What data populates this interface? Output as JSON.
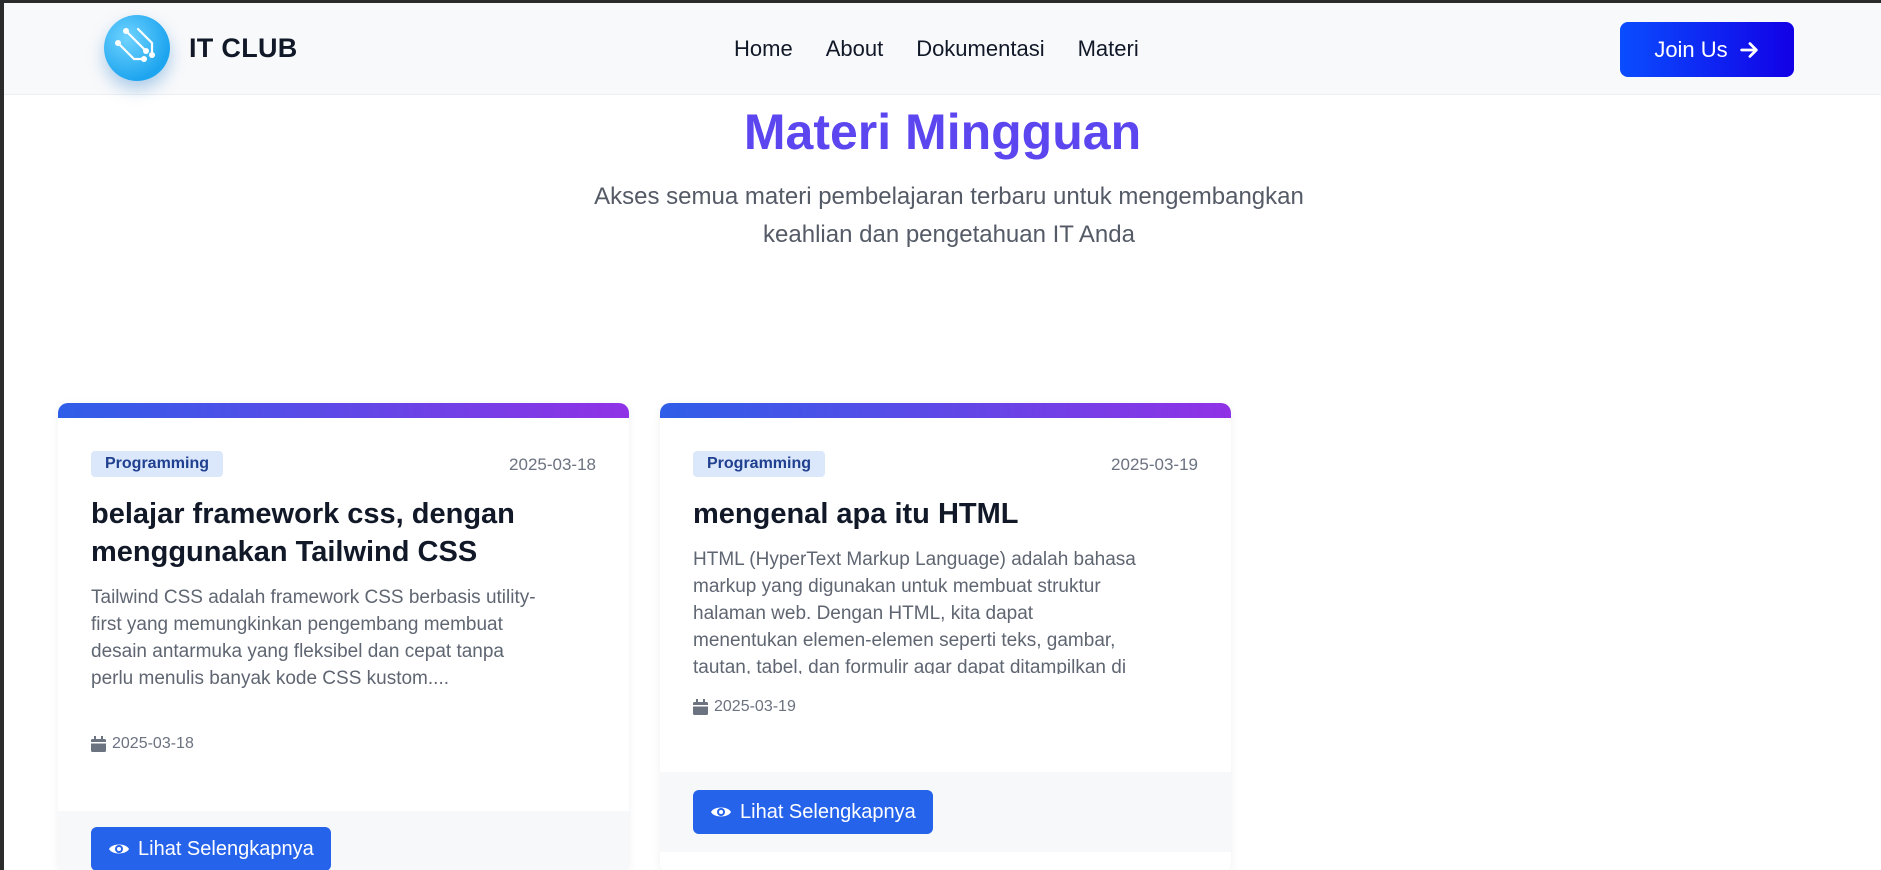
{
  "brand": {
    "name": "IT CLUB"
  },
  "nav": {
    "items": [
      "Home",
      "About",
      "Dokumentasi",
      "Materi"
    ]
  },
  "cta": {
    "label": "Join Us"
  },
  "hero": {
    "title": "Materi Mingguan",
    "subtitle_line1": "Akses semua materi pembelajaran terbaru untuk mengembangkan",
    "subtitle_line2": "keahlian dan pengetahuan IT Anda"
  },
  "cards": [
    {
      "tag": "Programming",
      "date": "2025-03-18",
      "title_line1": "belajar framework css, dengan",
      "title_line2": "menggunakan Tailwind CSS",
      "desc_lines": [
        "Tailwind CSS adalah framework CSS berbasis utility-",
        "first yang memungkinkan pengembang membuat",
        "desain antarmuka yang fleksibel dan cepat tanpa",
        "perlu menulis banyak kode CSS kustom...."
      ],
      "date_bottom": "2025-03-18",
      "button": "Lihat Selengkapnya"
    },
    {
      "tag": "Programming",
      "date": "2025-03-19",
      "title_line1": "mengenal apa itu HTML",
      "desc_lines": [
        "HTML (HyperText Markup Language) adalah bahasa",
        "markup yang digunakan untuk membuat struktur",
        "halaman web. Dengan HTML, kita dapat",
        "menentukan elemen-elemen seperti teks, gambar,",
        "tautan, tabel, dan formulir agar dapat ditampilkan di"
      ],
      "date_bottom": "2025-03-19",
      "button": "Lihat Selengkapnya"
    }
  ],
  "icons": {
    "logo": "circuit-icon",
    "cta": "arrow-right-icon",
    "date": "calendar-icon",
    "button": "eye-icon"
  },
  "colors": {
    "accent": "#5b46f0",
    "button": "#2563eb",
    "cta_start": "#0a4dff",
    "cta_end": "#1200e6",
    "card_bar_start": "#2f5ee8",
    "card_bar_end": "#9032e6"
  }
}
